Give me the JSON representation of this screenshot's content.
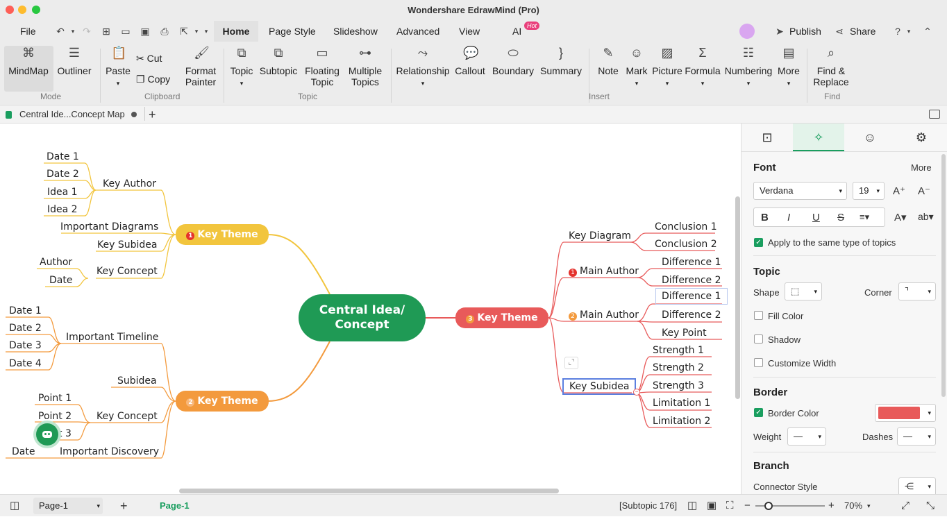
{
  "window": {
    "title": "Wondershare EdrawMind (Pro)"
  },
  "menu": {
    "file": "File",
    "tabs": [
      "Home",
      "Page Style",
      "Slideshow",
      "Advanced",
      "View"
    ],
    "ai": "AI",
    "hot": "Hot",
    "publish": "Publish",
    "share": "Share"
  },
  "ribbon": {
    "mindmap": "MindMap",
    "outliner": "Outliner",
    "mode_group": "Mode",
    "paste": "Paste",
    "cut": "Cut",
    "copy": "Copy",
    "format_painter": [
      "Format",
      "Painter"
    ],
    "clipboard_group": "Clipboard",
    "topic": "Topic",
    "subtopic": "Subtopic",
    "floating": [
      "Floating",
      "Topic"
    ],
    "multiple": [
      "Multiple",
      "Topics"
    ],
    "topic_group": "Topic",
    "relationship": "Relationship",
    "callout": "Callout",
    "boundary": "Boundary",
    "summary": "Summary",
    "note": "Note",
    "mark": "Mark",
    "picture": "Picture",
    "formula": "Formula",
    "numbering": "Numbering",
    "more": "More",
    "insert_group": "Insert",
    "find": [
      "Find &",
      "Replace"
    ],
    "find_group": "Find"
  },
  "doc_tab": {
    "name": "Central Ide...Concept Map"
  },
  "map": {
    "central": [
      "Central Idea/",
      "Concept"
    ],
    "theme1": {
      "badge": "1",
      "label": "Key Theme"
    },
    "theme2": {
      "badge": "2",
      "label": "Key Theme"
    },
    "theme3": {
      "badge": "3",
      "label": "Key Theme"
    },
    "key_author": "Key Author",
    "date1": "Date 1",
    "date2": "Date 2",
    "idea1": "Idea 1",
    "idea2": "Idea 2",
    "important_diagrams": "Important Diagrams",
    "key_subidea": "Key Subidea",
    "key_concept": "Key Concept",
    "author": "Author",
    "date": "Date",
    "important_timeline": "Important Timeline",
    "t_date1": "Date 1",
    "t_date2": "Date 2",
    "t_date3": "Date 3",
    "t_date4": "Date 4",
    "subidea": "Subidea",
    "key_concept2": "Key Concept",
    "point1": "Point 1",
    "point2": "Point 2",
    "point3": "t 3",
    "important_discovery": "Important Discovery",
    "disc_date": "Date",
    "key_diagram": "Key Diagram",
    "conclusion1": "Conclusion 1",
    "conclusion2": "Conclusion 2",
    "main_author1": {
      "badge": "1",
      "label": "Main Author"
    },
    "difference1": "Difference 1",
    "difference2": "Difference 2",
    "main_author2": {
      "badge": "2",
      "label": "Main Author"
    },
    "difference1b": "Difference 1",
    "difference2b": "Difference 2",
    "key_point": "Key Point",
    "key_subidea_r": "Key Subidea",
    "strength1": "Strength 1",
    "strength2": "Strength 2",
    "strength3": "Strength 3",
    "limitation1": "Limitation 1",
    "limitation2": "Limitation 2"
  },
  "panel": {
    "font_h": "Font",
    "more": "More",
    "font_family": "Verdana",
    "font_size": "19",
    "apply_same": "Apply to the same type of topics",
    "topic_h": "Topic",
    "shape": "Shape",
    "corner": "Corner",
    "fill_color": "Fill Color",
    "shadow": "Shadow",
    "customize_width": "Customize Width",
    "border_h": "Border",
    "border_color": "Border Color",
    "weight": "Weight",
    "dashes": "Dashes",
    "branch_h": "Branch",
    "connector_style": "Connector Style"
  },
  "colors": {
    "yellow": "#f2c53d",
    "orange": "#f39a3d",
    "red": "#e85a5a",
    "green": "#1f9a55",
    "accent": "#1a9e5f"
  },
  "status": {
    "page_select": "Page-1",
    "page_tab": "Page-1",
    "subtopic": "[Subtopic 176]",
    "zoom": "70%"
  }
}
